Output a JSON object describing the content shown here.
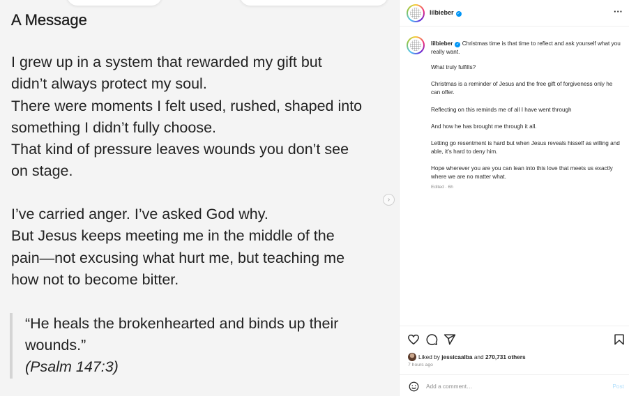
{
  "media": {
    "title": "A Message",
    "paragraph1": [
      "I grew up in a system that rewarded my gift but",
      "didn’t always protect my soul.",
      "There were moments I felt used, rushed, shaped into",
      "something I didn’t fully choose.",
      "That kind of pressure leaves wounds you don’t see",
      "on stage."
    ],
    "paragraph2": [
      "I’ve carried anger. I’ve asked God why.",
      "But Jesus keeps meeting me in the middle of the",
      "pain—not excusing what hurt me, but teaching me",
      "how not to become bitter."
    ],
    "quote": [
      "“He heals the brokenhearted and binds up their",
      "wounds.”"
    ],
    "citation": "(Psalm 147:3)",
    "next_glyph": "›"
  },
  "header": {
    "username": "lilbieber",
    "verified_glyph": "✓",
    "more_glyph": "···"
  },
  "caption": {
    "username": "lilbieber",
    "lines": [
      "Christmas time is that time to reflect and ask yourself what you really want.",
      "What truly fulfills?",
      "Christmas is a reminder of Jesus and the free gift of forgiveness only he can offer.",
      "Reflecting on this reminds me of all I have went through",
      "And how he has brought me through it all.",
      "Letting go resentment is hard but when Jesus reveals hisself as willing and able, it’s hard to deny him.",
      "Hope wherever you are you can lean into this love that meets us exactly where we are no matter what."
    ],
    "edited": "Edited · 6h"
  },
  "actions": {
    "icons": [
      "heart-icon",
      "comment-icon",
      "share-icon",
      "bookmark-icon"
    ],
    "liked_prefix": "Liked by ",
    "liked_user": "jessicaalba",
    "liked_middle": " and ",
    "liked_count": "270,731 others",
    "time_ago": "7 hours ago"
  },
  "comment": {
    "placeholder": "Add a comment…",
    "post_label": "Post",
    "post_color": "#b2dffc"
  },
  "colors": {
    "verified": "#0095f6",
    "muted": "#8e8e8e",
    "text": "#262626"
  }
}
